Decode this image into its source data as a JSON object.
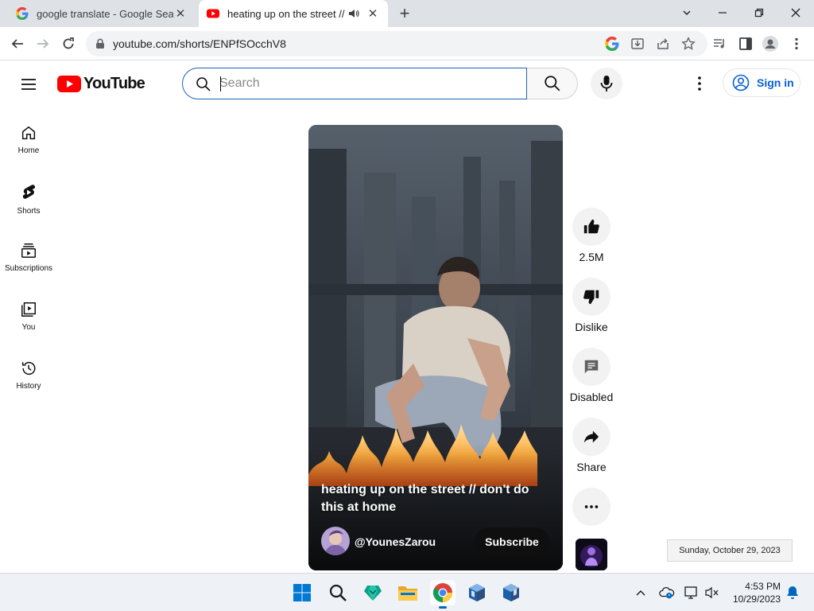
{
  "browser": {
    "tabs": [
      {
        "title": "google translate - Google Search",
        "icon": "google-g-icon",
        "active": false
      },
      {
        "title": "heating up on the street // don't do this at home",
        "icon": "youtube-icon",
        "active": true,
        "audio": "speaker-icon"
      }
    ],
    "url": "youtube.com/shorts/ENPfSOcchV8"
  },
  "youtube": {
    "logo_text": "YouTube",
    "search": {
      "placeholder": "Search",
      "value": ""
    },
    "signin_label": "Sign in",
    "guide": [
      {
        "label": "Home",
        "icon": "home-icon"
      },
      {
        "label": "Shorts",
        "icon": "shorts-icon"
      },
      {
        "label": "Subscriptions",
        "icon": "subscriptions-icon"
      },
      {
        "label": "You",
        "icon": "you-icon"
      },
      {
        "label": "History",
        "icon": "history-icon"
      }
    ],
    "short": {
      "caption": "heating up on the street // don't do this at home",
      "channel": "@YounesZarou",
      "subscribe_label": "Subscribe"
    },
    "actions": {
      "likes": "2.5M",
      "dislike": "Dislike",
      "comments": "Disabled",
      "share": "Share"
    },
    "colors": {
      "brand_red": "#ff0000",
      "link_blue": "#065fd4"
    }
  },
  "tooltip": {
    "text": "Sunday, October 29, 2023"
  },
  "taskbar": {
    "apps": [
      "start-icon",
      "search-icon",
      "security-icon",
      "file-explorer-icon",
      "chrome-icon",
      "virtualbox-icon",
      "virtualbox-icon"
    ],
    "time": "4:53 PM",
    "date": "10/29/2023"
  }
}
